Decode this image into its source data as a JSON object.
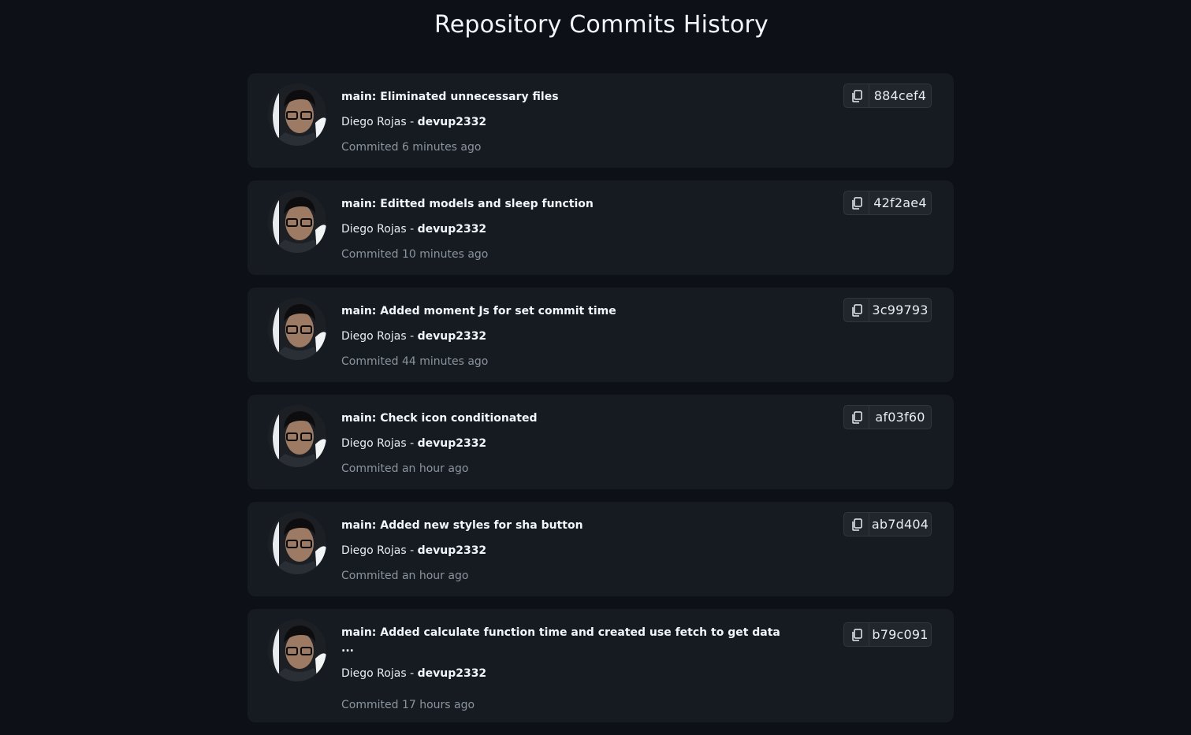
{
  "page": {
    "title": "Repository Commits History"
  },
  "commits": [
    {
      "message": "main: Eliminated unnecessary files",
      "author_name": "Diego Rojas",
      "separator": " - ",
      "username": "devup2332",
      "time": "Commited 6 minutes ago",
      "sha": "884cef4",
      "copy_icon": "copy-icon"
    },
    {
      "message": "main: Editted models and sleep function",
      "author_name": "Diego Rojas",
      "separator": " - ",
      "username": "devup2332",
      "time": "Commited 10 minutes ago",
      "sha": "42f2ae4",
      "copy_icon": "copy-icon"
    },
    {
      "message": "main: Added moment Js for set commit time",
      "author_name": "Diego Rojas",
      "separator": " - ",
      "username": "devup2332",
      "time": "Commited 44 minutes ago",
      "sha": "3c99793",
      "copy_icon": "copy-icon"
    },
    {
      "message": "main: Check icon conditionated",
      "author_name": "Diego Rojas",
      "separator": " - ",
      "username": "devup2332",
      "time": "Commited an hour ago",
      "sha": "af03f60",
      "copy_icon": "copy-icon"
    },
    {
      "message": "main: Added new styles for sha button",
      "author_name": "Diego Rojas",
      "separator": " - ",
      "username": "devup2332",
      "time": "Commited an hour ago",
      "sha": "ab7d404",
      "copy_icon": "copy-icon"
    },
    {
      "message": "main: Added calculate function time and created use fetch to get data\n...",
      "author_name": "Diego Rojas",
      "separator": " - ",
      "username": "devup2332",
      "time": "Commited 17 hours ago",
      "sha": "b79c091",
      "copy_icon": "copy-icon"
    }
  ],
  "colors": {
    "background": "#0d1117",
    "card": "#161b22",
    "text": "#e6edf3",
    "muted": "#8b949e",
    "border": "#30363d"
  }
}
